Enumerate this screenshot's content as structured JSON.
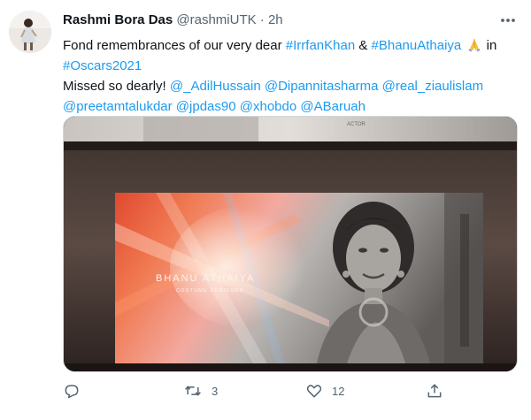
{
  "author": {
    "name": "Rashmi Bora Das",
    "handle": "@rashmiUTK",
    "separator": "·",
    "time": "2h"
  },
  "icons": {
    "more": "more-horizontal-icon",
    "reply": "reply-icon",
    "retweet": "retweet-icon",
    "like": "like-icon",
    "share": "share-icon",
    "emoji": "folded-hands-emoji"
  },
  "tweet": {
    "line1": {
      "a": "Fond remembrances of our very dear ",
      "tag1": "#IrrfanKhan",
      "amp": " & ",
      "tag2": "#BhanuAthaiya",
      "b": " in"
    },
    "line2": {
      "tag": "#Oscars2021"
    },
    "line3": {
      "a": "Missed so dearly! ",
      "m1": "@_AdilHussain",
      "m2": "@Dipannitasharma",
      "m3": "@real_ziaulislam"
    },
    "line4": {
      "m4": "@preetamtalukdar",
      "m5": "@jpdas90",
      "m6": "@xhobdo",
      "m7": "@ABaruah"
    }
  },
  "media": {
    "top_caption": "ACTOR",
    "name": "BHANU ATHAIYA",
    "role": "COSTUME DESIGNER"
  },
  "counts": {
    "retweets": "3",
    "likes": "12"
  },
  "colors": {
    "link": "#1d9bf0",
    "secondary": "#536471",
    "text": "#0f1419",
    "border": "#cfd9de"
  }
}
